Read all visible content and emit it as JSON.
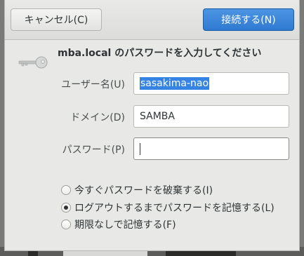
{
  "dialog": {
    "cancel_label": "キャンセル(C)",
    "connect_label": "接続する(N)",
    "heading": "mba.local のパスワードを入力してください"
  },
  "form": {
    "username": {
      "label": "ユーザー名(U)",
      "value": "sasakima-nao"
    },
    "domain": {
      "label": "ドメイン(D)",
      "value": "SAMBA"
    },
    "password": {
      "label": "パスワード(P)",
      "value": ""
    }
  },
  "remember_options": [
    {
      "label": "今すぐパスワードを破棄する(I)",
      "checked": false
    },
    {
      "label": "ログアウトするまでパスワードを記憶する(L)",
      "checked": true
    },
    {
      "label": "期限なしで記憶する(F)",
      "checked": false
    }
  ],
  "icons": {
    "dialog_icon": "key-icon"
  },
  "colors": {
    "accent": "#3584e4",
    "connect_button": "#2f79d1",
    "background": "#e8e8e7"
  }
}
